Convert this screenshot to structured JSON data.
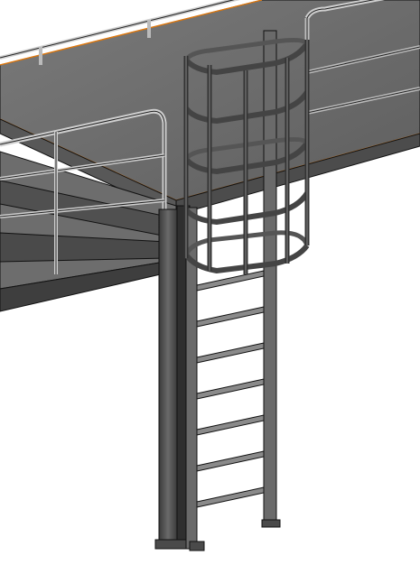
{
  "app": {
    "view": "3d-model-viewport"
  },
  "model": {
    "subject": "platform-with-caged-ladder",
    "colors": {
      "background": "#ffffff",
      "platform_top": "#6a6a6a",
      "platform_shade": "#5a5a5a",
      "steel": "#4a4a4a",
      "steel_dark": "#2f2f2f",
      "steel_light": "#8a8a8a",
      "edge": "#111111",
      "selection_edge": "#e07a10",
      "railing": "#bdbdbd"
    }
  }
}
